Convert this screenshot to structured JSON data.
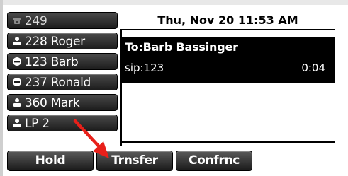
{
  "line_keys": [
    {
      "label": "249",
      "icon": "phone-icon"
    },
    {
      "label": "228 Roger",
      "icon": "person-icon"
    },
    {
      "label": "123 Barb",
      "icon": "minus-icon"
    },
    {
      "label": "237 Ronald",
      "icon": "minus-icon"
    },
    {
      "label": "360 Mark",
      "icon": "person-icon"
    },
    {
      "label": "LP 2",
      "icon": "person-icon"
    }
  ],
  "datetime": "Thu, Nov 20  11:53 AM",
  "call": {
    "to": "To:Barb Bassinger",
    "address": "sip:123",
    "duration": "0:04"
  },
  "softkeys": {
    "hold": "Hold",
    "transfer": "Trnsfer",
    "conference": "Confrnc"
  },
  "colors": {
    "annotation_arrow": "#e8201a",
    "panel_background": "#000000",
    "key_background": "#2a2a2a"
  }
}
